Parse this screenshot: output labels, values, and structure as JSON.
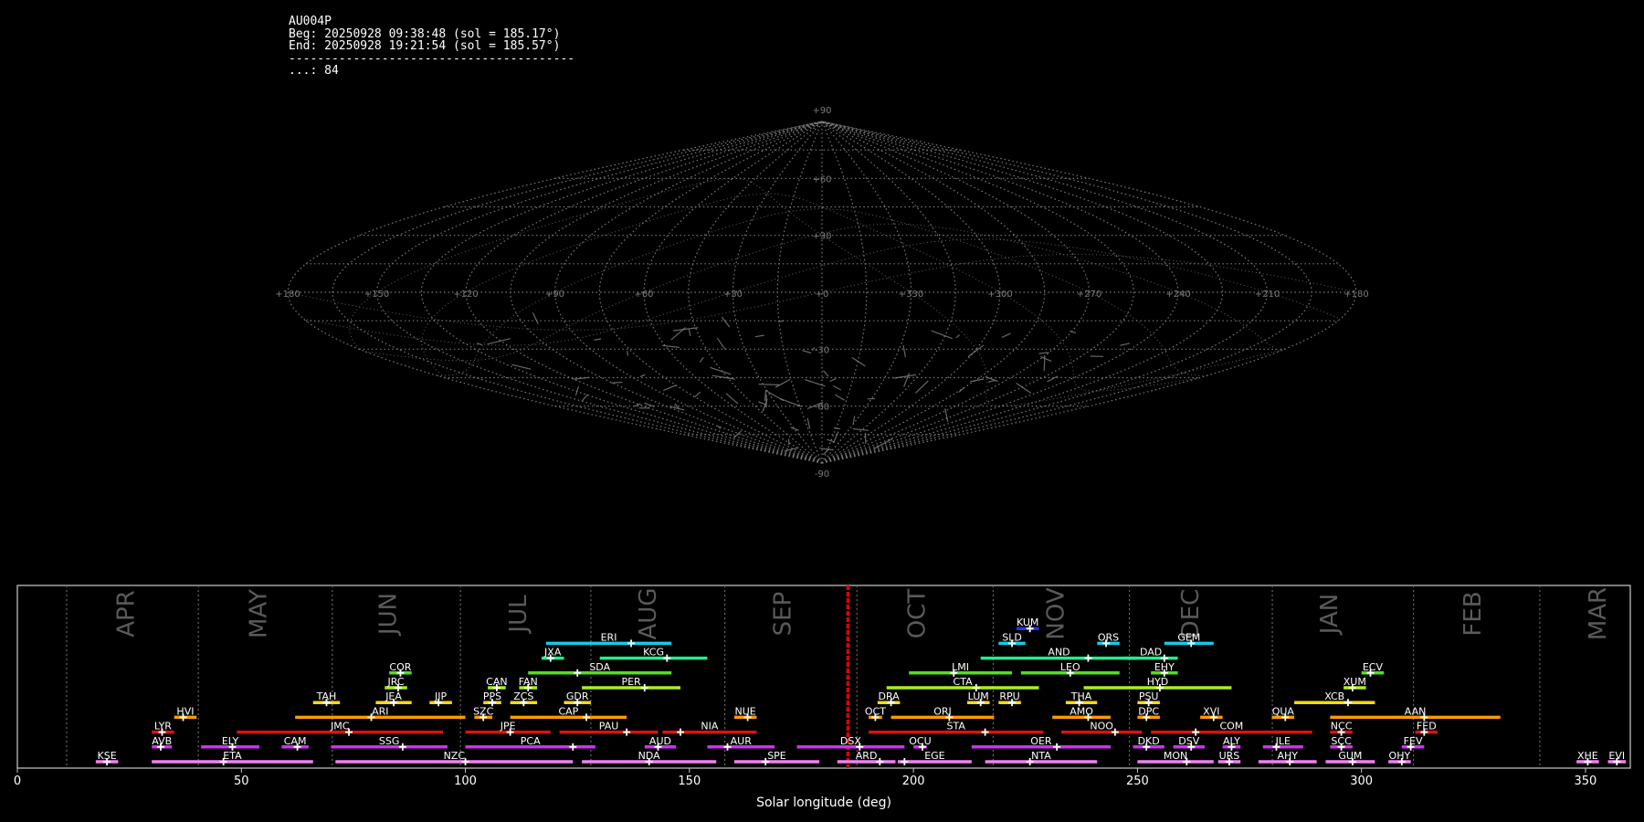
{
  "info": {
    "station": "AU004P",
    "begin": "Beg: 20250928 09:38:48 (sol = 185.17°)",
    "end": "End: 20250928 19:21:54 (sol = 185.57°)",
    "separator": "----------------------------------------",
    "count": "...: 84"
  },
  "colors": {
    "background": "#000000",
    "grid": "#7a7a7a",
    "tracks": "#8a8a8a",
    "current_sol_line": "#e00000",
    "frame": "#cccccc",
    "month_label": "#5a5a5a"
  },
  "chart_data": [
    {
      "type": "sky_map",
      "projection": "sinusoidal",
      "meridian_labels": [
        "+180",
        "+150",
        "+120",
        "+90",
        "+60",
        "+30",
        "+0",
        "+330",
        "+300",
        "+270",
        "+240",
        "+210",
        "+180"
      ],
      "parallel_labels": [
        "+90",
        "+60",
        "+30",
        "-30",
        "-60",
        "-90"
      ]
    },
    {
      "type": "timeline",
      "xlabel": "Solar longitude (deg)",
      "xlim": [
        0,
        360
      ],
      "xticks": [
        0,
        50,
        100,
        150,
        200,
        250,
        300,
        350
      ],
      "current_sol": 185.37,
      "months": [
        {
          "label": "APR",
          "start": 11.0,
          "center": 24.5
        },
        {
          "label": "MAY",
          "start": 40.4,
          "center": 54.0
        },
        {
          "label": "JUN",
          "start": 70.3,
          "center": 83.0
        },
        {
          "label": "JUL",
          "start": 98.9,
          "center": 112.0
        },
        {
          "label": "AUG",
          "start": 128.0,
          "center": 141.0
        },
        {
          "label": "SEP",
          "start": 157.9,
          "center": 171.0
        },
        {
          "label": "OCT",
          "start": 187.4,
          "center": 201.0
        },
        {
          "label": "NOV",
          "start": 217.8,
          "center": 232.0
        },
        {
          "label": "DEC",
          "start": 248.2,
          "center": 262.0
        },
        {
          "label": "JAN",
          "start": 280.1,
          "center": 293.0
        },
        {
          "label": "FEB",
          "start": 311.6,
          "center": 325.0
        },
        {
          "label": "MAR",
          "start": 339.8,
          "center": 353.0
        }
      ],
      "showers": [
        {
          "code": "KSE",
          "start": 17.5,
          "end": 22.5,
          "peak": 20.0,
          "row": 0,
          "color": "#ee82ee"
        },
        {
          "code": "ETA",
          "start": 30.0,
          "end": 66.0,
          "peak": 46.0,
          "row": 0,
          "color": "#ee82ee"
        },
        {
          "code": "NZC",
          "start": 71.0,
          "end": 124.0,
          "peak": 100.0,
          "row": 0,
          "color": "#ee82ee"
        },
        {
          "code": "NDA",
          "start": 126.0,
          "end": 156.0,
          "peak": 141.0,
          "row": 0,
          "color": "#ee82ee"
        },
        {
          "code": "SPE",
          "start": 160.0,
          "end": 179.0,
          "peak": 167.0,
          "row": 0,
          "color": "#ee82ee"
        },
        {
          "code": "ARD",
          "start": 183.0,
          "end": 196.0,
          "peak": 192.5,
          "row": 0,
          "color": "#ee82ee"
        },
        {
          "code": "EGE",
          "start": 196.5,
          "end": 213.0,
          "peak": 198.0,
          "row": 0,
          "color": "#ee82ee"
        },
        {
          "code": "NTA",
          "start": 216.0,
          "end": 241.0,
          "peak": 226.0,
          "row": 0,
          "color": "#ee82ee"
        },
        {
          "code": "MON",
          "start": 250.0,
          "end": 267.0,
          "peak": 261.0,
          "row": 0,
          "color": "#ee82ee"
        },
        {
          "code": "URS",
          "start": 268.0,
          "end": 273.0,
          "peak": 270.5,
          "row": 0,
          "color": "#ee82ee"
        },
        {
          "code": "AHY",
          "start": 277.0,
          "end": 290.0,
          "peak": 284.0,
          "row": 0,
          "color": "#ee82ee"
        },
        {
          "code": "GUM",
          "start": 292.0,
          "end": 303.0,
          "peak": 298.0,
          "row": 0,
          "color": "#ee82ee"
        },
        {
          "code": "OHY",
          "start": 306.0,
          "end": 311.0,
          "peak": 309.0,
          "row": 0,
          "color": "#ee82ee"
        },
        {
          "code": "XHE",
          "start": 348.0,
          "end": 353.0,
          "peak": 350.5,
          "row": 0,
          "color": "#ee82ee"
        },
        {
          "code": "EVI",
          "start": 355.0,
          "end": 359.0,
          "peak": 357.0,
          "row": 0,
          "color": "#ee82ee"
        },
        {
          "code": "AVB",
          "start": 30.0,
          "end": 34.5,
          "peak": 32.0,
          "row": 1,
          "color": "#cc33ee"
        },
        {
          "code": "ELY",
          "start": 41.0,
          "end": 54.0,
          "peak": 48.0,
          "row": 1,
          "color": "#cc33ee"
        },
        {
          "code": "CAM",
          "start": 59.0,
          "end": 65.0,
          "peak": 62.5,
          "row": 1,
          "color": "#cc33ee"
        },
        {
          "code": "SSG",
          "start": 70.0,
          "end": 96.0,
          "peak": 86.0,
          "row": 1,
          "color": "#cc33ee"
        },
        {
          "code": "PCA",
          "start": 100.0,
          "end": 129.0,
          "peak": 124.0,
          "row": 1,
          "color": "#cc33ee"
        },
        {
          "code": "AUD",
          "start": 140.0,
          "end": 147.0,
          "peak": 143.0,
          "row": 1,
          "color": "#cc33ee"
        },
        {
          "code": "AUR",
          "start": 154.0,
          "end": 169.0,
          "peak": 158.5,
          "row": 1,
          "color": "#cc33ee"
        },
        {
          "code": "DSX",
          "start": 174.0,
          "end": 198.0,
          "peak": 188.0,
          "row": 1,
          "color": "#cc33ee"
        },
        {
          "code": "OCU",
          "start": 200.0,
          "end": 203.0,
          "peak": 202.0,
          "row": 1,
          "color": "#cc33ee"
        },
        {
          "code": "OER",
          "start": 213.0,
          "end": 244.0,
          "peak": 232.0,
          "row": 1,
          "color": "#cc33ee"
        },
        {
          "code": "DKD",
          "start": 249.0,
          "end": 256.0,
          "peak": 252.0,
          "row": 1,
          "color": "#cc33ee"
        },
        {
          "code": "DSV",
          "start": 258.0,
          "end": 265.0,
          "peak": 262.0,
          "row": 1,
          "color": "#cc33ee"
        },
        {
          "code": "ALY",
          "start": 269.0,
          "end": 273.0,
          "peak": 271.0,
          "row": 1,
          "color": "#cc33ee"
        },
        {
          "code": "JLE",
          "start": 278.0,
          "end": 287.0,
          "peak": 281.0,
          "row": 1,
          "color": "#cc33ee"
        },
        {
          "code": "SCC",
          "start": 293.0,
          "end": 298.0,
          "peak": 295.5,
          "row": 1,
          "color": "#cc33ee"
        },
        {
          "code": "FEV",
          "start": 309.0,
          "end": 314.0,
          "peak": 311.0,
          "row": 1,
          "color": "#cc33ee"
        },
        {
          "code": "LYR",
          "start": 30.0,
          "end": 35.0,
          "peak": 32.3,
          "row": 2,
          "color": "#dd1111"
        },
        {
          "code": "JMC",
          "start": 49.0,
          "end": 95.0,
          "peak": 74.0,
          "row": 2,
          "color": "#dd1111"
        },
        {
          "code": "JPE",
          "start": 100.0,
          "end": 119.0,
          "peak": 110.0,
          "row": 2,
          "color": "#dd1111"
        },
        {
          "code": "PAU",
          "start": 121.0,
          "end": 143.0,
          "peak": 136.0,
          "row": 2,
          "color": "#dd1111"
        },
        {
          "code": "NIA",
          "start": 144.0,
          "end": 165.0,
          "peak": 148.0,
          "row": 2,
          "color": "#dd1111"
        },
        {
          "code": "STA",
          "start": 190.0,
          "end": 229.0,
          "peak": 216.0,
          "row": 2,
          "color": "#dd1111"
        },
        {
          "code": "NOO",
          "start": 233.0,
          "end": 251.0,
          "peak": 245.0,
          "row": 2,
          "color": "#dd1111"
        },
        {
          "code": "COM",
          "start": 253.0,
          "end": 289.0,
          "peak": 263.0,
          "row": 2,
          "color": "#dd1111"
        },
        {
          "code": "NCC",
          "start": 293.0,
          "end": 298.0,
          "peak": 295.5,
          "row": 2,
          "color": "#dd1111"
        },
        {
          "code": "FED",
          "start": 312.0,
          "end": 317.0,
          "peak": 314.0,
          "row": 2,
          "color": "#dd1111"
        },
        {
          "code": "HVI",
          "start": 35.0,
          "end": 40.0,
          "peak": 37.0,
          "row": 3,
          "color": "#ff9900"
        },
        {
          "code": "ARI",
          "start": 62.0,
          "end": 100.0,
          "peak": 79.0,
          "row": 3,
          "color": "#ff9900"
        },
        {
          "code": "SZC",
          "start": 102.0,
          "end": 106.0,
          "peak": 104.0,
          "row": 3,
          "color": "#ff9900"
        },
        {
          "code": "CAP",
          "start": 110.0,
          "end": 136.0,
          "peak": 127.0,
          "row": 3,
          "color": "#ff9900"
        },
        {
          "code": "NUE",
          "start": 160.0,
          "end": 165.0,
          "peak": 163.0,
          "row": 3,
          "color": "#ff9900"
        },
        {
          "code": "OCT",
          "start": 190.0,
          "end": 193.0,
          "peak": 191.5,
          "row": 3,
          "color": "#ff9900"
        },
        {
          "code": "ORI",
          "start": 195.0,
          "end": 218.0,
          "peak": 208.0,
          "row": 3,
          "color": "#ff9900"
        },
        {
          "code": "AMO",
          "start": 231.0,
          "end": 244.0,
          "peak": 239.0,
          "row": 3,
          "color": "#ff9900"
        },
        {
          "code": "DPC",
          "start": 250.0,
          "end": 255.0,
          "peak": 252.0,
          "row": 3,
          "color": "#ff9900"
        },
        {
          "code": "XVI",
          "start": 264.0,
          "end": 269.0,
          "peak": 267.0,
          "row": 3,
          "color": "#ff9900"
        },
        {
          "code": "QUA",
          "start": 280.0,
          "end": 285.0,
          "peak": 283.0,
          "row": 3,
          "color": "#ff9900"
        },
        {
          "code": "AAN",
          "start": 293.0,
          "end": 331.0,
          "peak": 314.0,
          "row": 3,
          "color": "#ff9900"
        },
        {
          "code": "TAH",
          "start": 66.0,
          "end": 72.0,
          "peak": 69.0,
          "row": 4,
          "color": "#ffdd00"
        },
        {
          "code": "JEA",
          "start": 80.0,
          "end": 88.0,
          "peak": 84.0,
          "row": 4,
          "color": "#ffdd00"
        },
        {
          "code": "JIP",
          "start": 92.0,
          "end": 97.0,
          "peak": 94.0,
          "row": 4,
          "color": "#ffdd00"
        },
        {
          "code": "PPS",
          "start": 104.0,
          "end": 108.0,
          "peak": 106.0,
          "row": 4,
          "color": "#ffdd00"
        },
        {
          "code": "ZCS",
          "start": 110.0,
          "end": 116.0,
          "peak": 113.0,
          "row": 4,
          "color": "#ffdd00"
        },
        {
          "code": "GDR",
          "start": 122.0,
          "end": 128.0,
          "peak": 125.0,
          "row": 4,
          "color": "#ffdd00"
        },
        {
          "code": "DRA",
          "start": 192.0,
          "end": 197.0,
          "peak": 195.0,
          "row": 4,
          "color": "#ffdd00"
        },
        {
          "code": "LUM",
          "start": 212.0,
          "end": 217.0,
          "peak": 215.0,
          "row": 4,
          "color": "#ffdd00"
        },
        {
          "code": "RPU",
          "start": 219.0,
          "end": 224.0,
          "peak": 222.0,
          "row": 4,
          "color": "#ffdd00"
        },
        {
          "code": "THA",
          "start": 234.0,
          "end": 241.0,
          "peak": 237.0,
          "row": 4,
          "color": "#ffdd00"
        },
        {
          "code": "PSU",
          "start": 250.0,
          "end": 255.0,
          "peak": 252.5,
          "row": 4,
          "color": "#ffdd00"
        },
        {
          "code": "XCB",
          "start": 285.0,
          "end": 303.0,
          "peak": 297.0,
          "row": 4,
          "color": "#ffdd00"
        },
        {
          "code": "JRC",
          "start": 82.0,
          "end": 87.0,
          "peak": 85.0,
          "row": 5,
          "color": "#aaee22"
        },
        {
          "code": "CAN",
          "start": 105.0,
          "end": 109.0,
          "peak": 107.0,
          "row": 5,
          "color": "#aaee22"
        },
        {
          "code": "FAN",
          "start": 112.0,
          "end": 116.0,
          "peak": 114.0,
          "row": 5,
          "color": "#aaee22"
        },
        {
          "code": "PER",
          "start": 126.0,
          "end": 148.0,
          "peak": 140.0,
          "row": 5,
          "color": "#aaee22"
        },
        {
          "code": "CTA",
          "start": 194.0,
          "end": 228.0,
          "peak": 214.0,
          "row": 5,
          "color": "#aaee22"
        },
        {
          "code": "HYD",
          "start": 238.0,
          "end": 271.0,
          "peak": 255.0,
          "row": 5,
          "color": "#aaee22"
        },
        {
          "code": "XUM",
          "start": 296.0,
          "end": 301.0,
          "peak": 298.0,
          "row": 5,
          "color": "#aaee22"
        },
        {
          "code": "COR",
          "start": 83.0,
          "end": 88.0,
          "peak": 85.5,
          "row": 6,
          "color": "#55dd22"
        },
        {
          "code": "SDA",
          "start": 114.0,
          "end": 146.0,
          "peak": 125.0,
          "row": 6,
          "color": "#55dd22"
        },
        {
          "code": "LMI",
          "start": 199.0,
          "end": 222.0,
          "peak": 209.0,
          "row": 6,
          "color": "#55dd22"
        },
        {
          "code": "LEO",
          "start": 224.0,
          "end": 246.0,
          "peak": 235.0,
          "row": 6,
          "color": "#55dd22"
        },
        {
          "code": "EHY",
          "start": 253.0,
          "end": 259.0,
          "peak": 256.0,
          "row": 6,
          "color": "#55dd22"
        },
        {
          "code": "ECV",
          "start": 300.0,
          "end": 305.0,
          "peak": 302.0,
          "row": 6,
          "color": "#55dd22"
        },
        {
          "code": "JXA",
          "start": 117.0,
          "end": 122.0,
          "peak": 119.0,
          "row": 7,
          "color": "#22ee88"
        },
        {
          "code": "KCG",
          "start": 130.0,
          "end": 154.0,
          "peak": 145.0,
          "row": 7,
          "color": "#22ee88"
        },
        {
          "code": "AND",
          "start": 215.0,
          "end": 250.0,
          "peak": 239.0,
          "row": 7,
          "color": "#22ee88"
        },
        {
          "code": "DAD",
          "start": 247.0,
          "end": 259.0,
          "peak": 256.0,
          "row": 7,
          "color": "#22ee88"
        },
        {
          "code": "ERI",
          "start": 118.0,
          "end": 146.0,
          "peak": 137.0,
          "row": 8,
          "color": "#11ccee"
        },
        {
          "code": "SLD",
          "start": 219.0,
          "end": 225.0,
          "peak": 222.0,
          "row": 8,
          "color": "#11ccee"
        },
        {
          "code": "ORS",
          "start": 241.0,
          "end": 246.0,
          "peak": 243.0,
          "row": 8,
          "color": "#11ccee"
        },
        {
          "code": "GEM",
          "start": 256.0,
          "end": 267.0,
          "peak": 262.0,
          "row": 8,
          "color": "#11ccee"
        },
        {
          "code": "KUM",
          "start": 223.0,
          "end": 228.0,
          "peak": 226.0,
          "row": 9,
          "color": "#2233ee"
        }
      ]
    }
  ]
}
